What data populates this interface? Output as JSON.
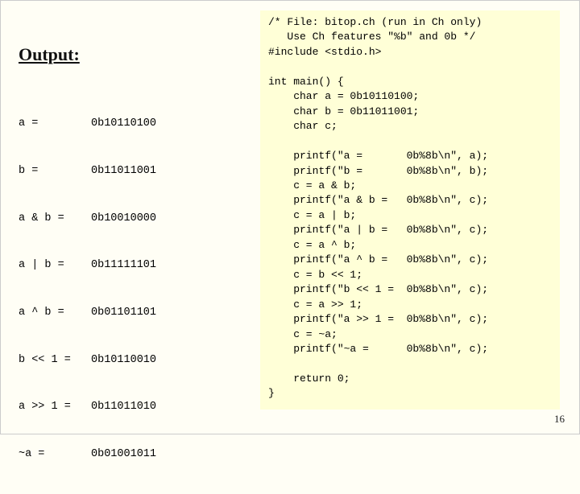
{
  "output": {
    "heading": "Output:",
    "rows": [
      {
        "label": "a =",
        "value": "0b10110100"
      },
      {
        "label": "b =",
        "value": "0b11011001"
      },
      {
        "label": "a & b =",
        "value": "0b10010000"
      },
      {
        "label": "a | b =",
        "value": "0b11111101"
      },
      {
        "label": "a ^ b =",
        "value": "0b01101101"
      },
      {
        "label": "b << 1 =",
        "value": "0b10110010"
      },
      {
        "label": "a >> 1 =",
        "value": "0b11011010"
      },
      {
        "label": "~a =",
        "value": "0b01001011"
      }
    ]
  },
  "code": {
    "lines": [
      "/* File: bitop.ch (run in Ch only)",
      "   Use Ch features \"%b\" and 0b */",
      "#include <stdio.h>",
      "",
      "int main() {",
      "    char a = 0b10110100;",
      "    char b = 0b11011001;",
      "    char c;",
      "",
      "    printf(\"a =       0b%8b\\n\", a);",
      "    printf(\"b =       0b%8b\\n\", b);",
      "    c = a & b;",
      "    printf(\"a & b =   0b%8b\\n\", c);",
      "    c = a | b;",
      "    printf(\"a | b =   0b%8b\\n\", c);",
      "    c = a ^ b;",
      "    printf(\"a ^ b =   0b%8b\\n\", c);",
      "    c = b << 1;",
      "    printf(\"b << 1 =  0b%8b\\n\", c);",
      "    c = a >> 1;",
      "    printf(\"a >> 1 =  0b%8b\\n\", c);",
      "    c = ~a;",
      "    printf(\"~a =      0b%8b\\n\", c);",
      "",
      "    return 0;",
      "}"
    ]
  },
  "page_number": "16"
}
